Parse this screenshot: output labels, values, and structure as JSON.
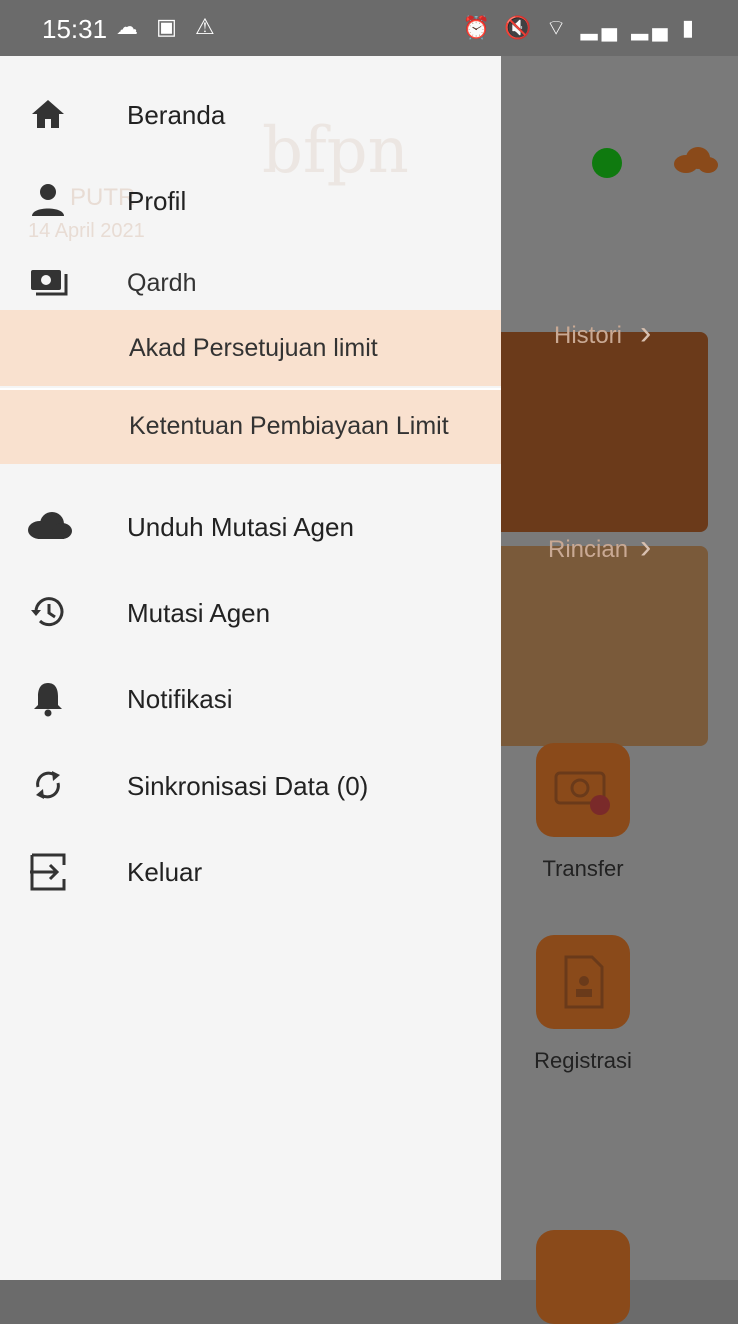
{
  "status_bar": {
    "time": "15:31",
    "left_icons": [
      "cloud-icon",
      "image-icon",
      "warning-icon"
    ],
    "right_icons": [
      "alarm-icon",
      "mute-icon",
      "wifi-icon",
      "signal-icon",
      "signal-icon",
      "battery-icon"
    ]
  },
  "background": {
    "card1_label": "Histori",
    "card2_label": "Rincian",
    "tiles": [
      {
        "label": "Transfer"
      },
      {
        "label": "Registrasi"
      }
    ]
  },
  "drawer": {
    "faded_texts": {
      "name": "PUTR",
      "date": "14 April 2021",
      "logo": "bfpn"
    },
    "items": [
      {
        "label": "Beranda",
        "icon": "home-icon"
      },
      {
        "label": "Profil",
        "icon": "person-icon"
      },
      {
        "label": "Qardh",
        "icon": "money-icon"
      }
    ],
    "sub_items": [
      {
        "label": "Akad Persetujuan limit"
      },
      {
        "label": "Ketentuan Pembiayaan Limit"
      }
    ],
    "items2": [
      {
        "label": "Unduh Mutasi Agen",
        "icon": "cloud-icon"
      },
      {
        "label": "Mutasi Agen",
        "icon": "history-icon"
      },
      {
        "label": "Notifikasi",
        "icon": "bell-icon"
      },
      {
        "label": "Sinkronisasi Data (0)",
        "icon": "sync-icon"
      },
      {
        "label": "Keluar",
        "icon": "logout-icon"
      }
    ]
  },
  "colors": {
    "accent": "#8a4a1a",
    "highlight": "#f9e1cf",
    "drawer_bg": "#f5f5f5",
    "scrim": "#6b6b6b"
  }
}
